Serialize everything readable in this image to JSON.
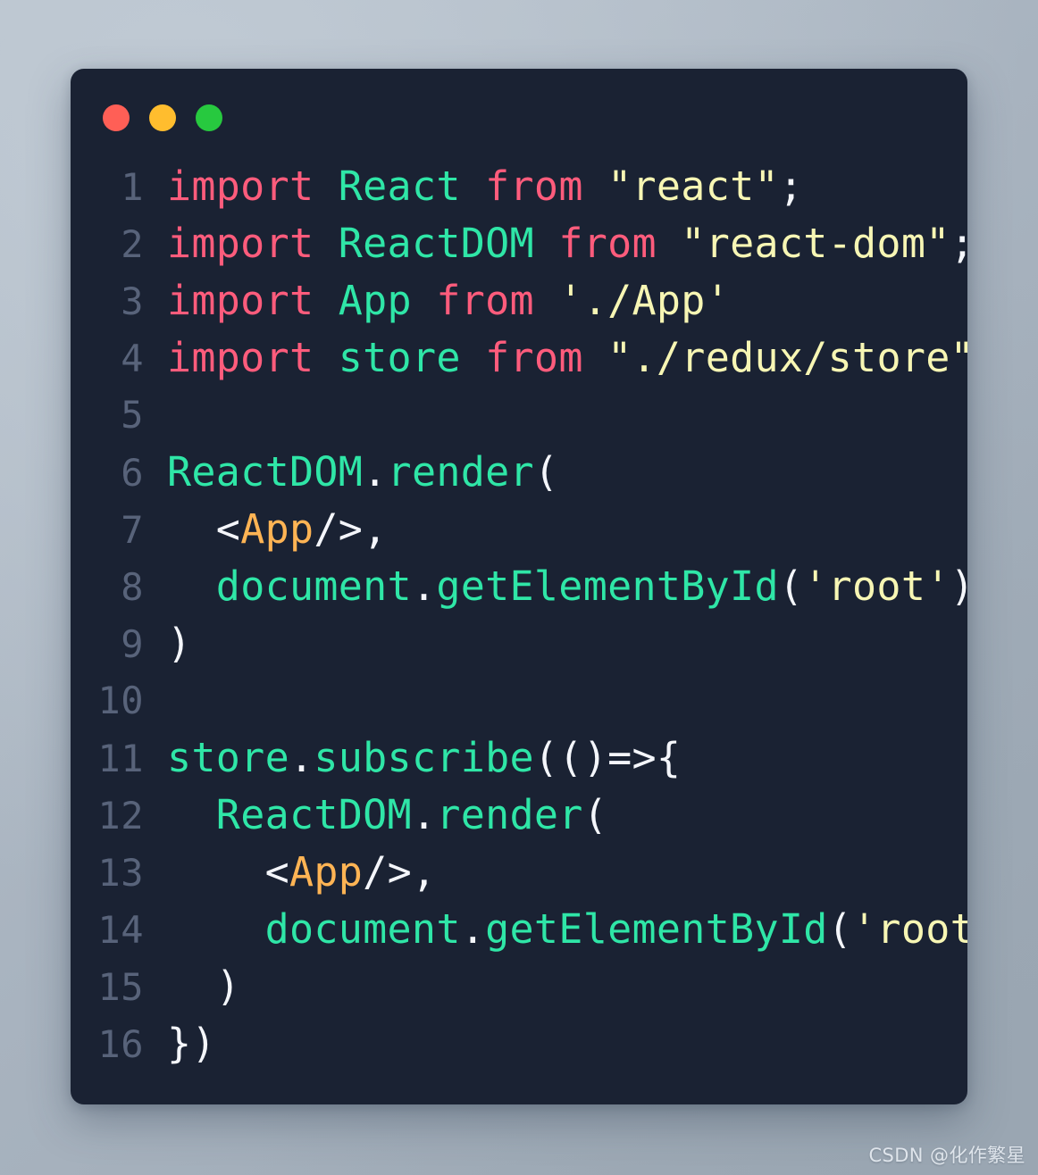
{
  "window": {
    "controls": [
      {
        "name": "close",
        "color": "#ff5f56",
        "label": ""
      },
      {
        "name": "minimize",
        "color": "#ffbd2e",
        "label": ""
      },
      {
        "name": "zoom",
        "color": "#27c93f",
        "label": ""
      }
    ]
  },
  "theme": {
    "card_background": "#1a2233",
    "page_background": "#a8b3bf",
    "line_number_color": "#58637a",
    "keyword_color": "#ff5c7c",
    "identifier_color": "#2fe6a7",
    "string_color": "#f7f6b4",
    "punctuation_color": "#f4f6fb",
    "jsx_tag_color": "#ffb454"
  },
  "editor": {
    "language": "javascript",
    "first_line_number": 1,
    "total_lines": 16,
    "lines": [
      {
        "number": "1",
        "text": "import React from \"react\";",
        "tokens": [
          {
            "t": "import",
            "k": "keyword"
          },
          {
            "t": " ",
            "k": "plain"
          },
          {
            "t": "React",
            "k": "ident"
          },
          {
            "t": " ",
            "k": "plain"
          },
          {
            "t": "from",
            "k": "keyword"
          },
          {
            "t": " ",
            "k": "plain"
          },
          {
            "t": "\"react\"",
            "k": "string"
          },
          {
            "t": ";",
            "k": "punct"
          }
        ]
      },
      {
        "number": "2",
        "text": "import ReactDOM from \"react-dom\";",
        "tokens": [
          {
            "t": "import",
            "k": "keyword"
          },
          {
            "t": " ",
            "k": "plain"
          },
          {
            "t": "ReactDOM",
            "k": "ident"
          },
          {
            "t": " ",
            "k": "plain"
          },
          {
            "t": "from",
            "k": "keyword"
          },
          {
            "t": " ",
            "k": "plain"
          },
          {
            "t": "\"react-dom\"",
            "k": "string"
          },
          {
            "t": ";",
            "k": "punct"
          }
        ]
      },
      {
        "number": "3",
        "text": "import App from './App'",
        "tokens": [
          {
            "t": "import",
            "k": "keyword"
          },
          {
            "t": " ",
            "k": "plain"
          },
          {
            "t": "App",
            "k": "ident"
          },
          {
            "t": " ",
            "k": "plain"
          },
          {
            "t": "from",
            "k": "keyword"
          },
          {
            "t": " ",
            "k": "plain"
          },
          {
            "t": "'./App'",
            "k": "string"
          }
        ]
      },
      {
        "number": "4",
        "text": "import store from \"./redux/store\";",
        "tokens": [
          {
            "t": "import",
            "k": "keyword"
          },
          {
            "t": " ",
            "k": "plain"
          },
          {
            "t": "store",
            "k": "ident"
          },
          {
            "t": " ",
            "k": "plain"
          },
          {
            "t": "from",
            "k": "keyword"
          },
          {
            "t": " ",
            "k": "plain"
          },
          {
            "t": "\"./redux/store\"",
            "k": "string"
          },
          {
            "t": ";",
            "k": "punct"
          }
        ]
      },
      {
        "number": "5",
        "text": "",
        "tokens": []
      },
      {
        "number": "6",
        "text": "ReactDOM.render(",
        "tokens": [
          {
            "t": "ReactDOM",
            "k": "ident"
          },
          {
            "t": ".",
            "k": "punct"
          },
          {
            "t": "render",
            "k": "ident"
          },
          {
            "t": "(",
            "k": "punct"
          }
        ]
      },
      {
        "number": "7",
        "text": "  <App/>,",
        "tokens": [
          {
            "t": "  ",
            "k": "plain"
          },
          {
            "t": "<",
            "k": "punct"
          },
          {
            "t": "App",
            "k": "tag"
          },
          {
            "t": "/>",
            "k": "punct"
          },
          {
            "t": ",",
            "k": "punct"
          }
        ]
      },
      {
        "number": "8",
        "text": "  document.getElementById('root')",
        "tokens": [
          {
            "t": "  ",
            "k": "plain"
          },
          {
            "t": "document",
            "k": "ident"
          },
          {
            "t": ".",
            "k": "punct"
          },
          {
            "t": "getElementById",
            "k": "ident"
          },
          {
            "t": "(",
            "k": "punct"
          },
          {
            "t": "'root'",
            "k": "string"
          },
          {
            "t": ")",
            "k": "punct"
          }
        ]
      },
      {
        "number": "9",
        "text": ")",
        "tokens": [
          {
            "t": ")",
            "k": "punct"
          }
        ]
      },
      {
        "number": "10",
        "text": "",
        "tokens": []
      },
      {
        "number": "11",
        "text": "store.subscribe(()=>{",
        "tokens": [
          {
            "t": "store",
            "k": "ident"
          },
          {
            "t": ".",
            "k": "punct"
          },
          {
            "t": "subscribe",
            "k": "ident"
          },
          {
            "t": "(()=>{",
            "k": "punct"
          }
        ]
      },
      {
        "number": "12",
        "text": "  ReactDOM.render(",
        "tokens": [
          {
            "t": "  ",
            "k": "plain"
          },
          {
            "t": "ReactDOM",
            "k": "ident"
          },
          {
            "t": ".",
            "k": "punct"
          },
          {
            "t": "render",
            "k": "ident"
          },
          {
            "t": "(",
            "k": "punct"
          }
        ]
      },
      {
        "number": "13",
        "text": "    <App/>,",
        "tokens": [
          {
            "t": "    ",
            "k": "plain"
          },
          {
            "t": "<",
            "k": "punct"
          },
          {
            "t": "App",
            "k": "tag"
          },
          {
            "t": "/>",
            "k": "punct"
          },
          {
            "t": ",",
            "k": "punct"
          }
        ]
      },
      {
        "number": "14",
        "text": "    document.getElementById('root')",
        "tokens": [
          {
            "t": "    ",
            "k": "plain"
          },
          {
            "t": "document",
            "k": "ident"
          },
          {
            "t": ".",
            "k": "punct"
          },
          {
            "t": "getElementById",
            "k": "ident"
          },
          {
            "t": "(",
            "k": "punct"
          },
          {
            "t": "'root'",
            "k": "string"
          },
          {
            "t": ")",
            "k": "punct"
          }
        ]
      },
      {
        "number": "15",
        "text": "  )",
        "tokens": [
          {
            "t": "  ",
            "k": "plain"
          },
          {
            "t": ")",
            "k": "punct"
          }
        ]
      },
      {
        "number": "16",
        "text": "})",
        "tokens": [
          {
            "t": "})",
            "k": "punct"
          }
        ]
      }
    ]
  },
  "watermark": {
    "text": "CSDN @化作繁星"
  }
}
